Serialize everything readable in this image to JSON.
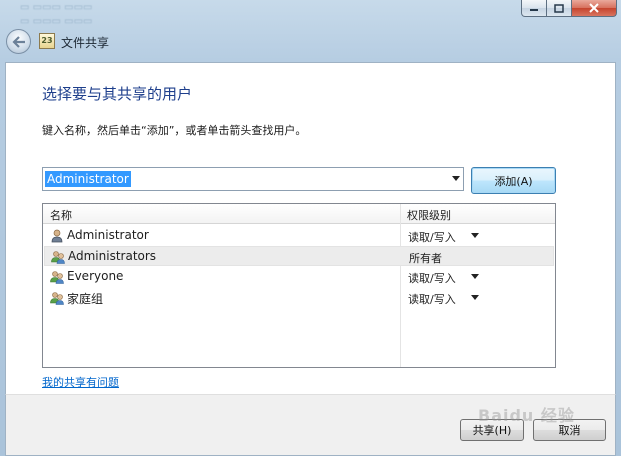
{
  "window": {
    "title": "文件共享",
    "caption": {
      "minimize": "–",
      "maximize": "□",
      "close": "✕"
    }
  },
  "dialog": {
    "heading": "选择要与其共享的用户",
    "instruction": "键入名称，然后单击“添加”，或者单击箭头查找用户。",
    "combo_value": "Administrator",
    "add_label": "添加(A)",
    "list": {
      "columns": [
        "名称",
        "权限级别"
      ],
      "rows": [
        {
          "name": "Administrator",
          "permission": "读取/写入",
          "icon": "user-icon",
          "has_dropdown": true
        },
        {
          "name": "Administrators",
          "permission": "所有者",
          "icon": "group-icon",
          "has_dropdown": false
        },
        {
          "name": "Everyone",
          "permission": "读取/写入",
          "icon": "group-icon",
          "has_dropdown": true
        },
        {
          "name": "家庭组",
          "permission": "读取/写入",
          "icon": "group-icon",
          "has_dropdown": true
        }
      ]
    },
    "help_link": "我的共享有问题"
  },
  "footer": {
    "share_label": "共享(H)",
    "cancel_label": "取消"
  },
  "watermark": "Baidu 经验",
  "colors": {
    "heading": "#1e3f8c",
    "link": "#0066cc",
    "selection": "#3399ff"
  }
}
